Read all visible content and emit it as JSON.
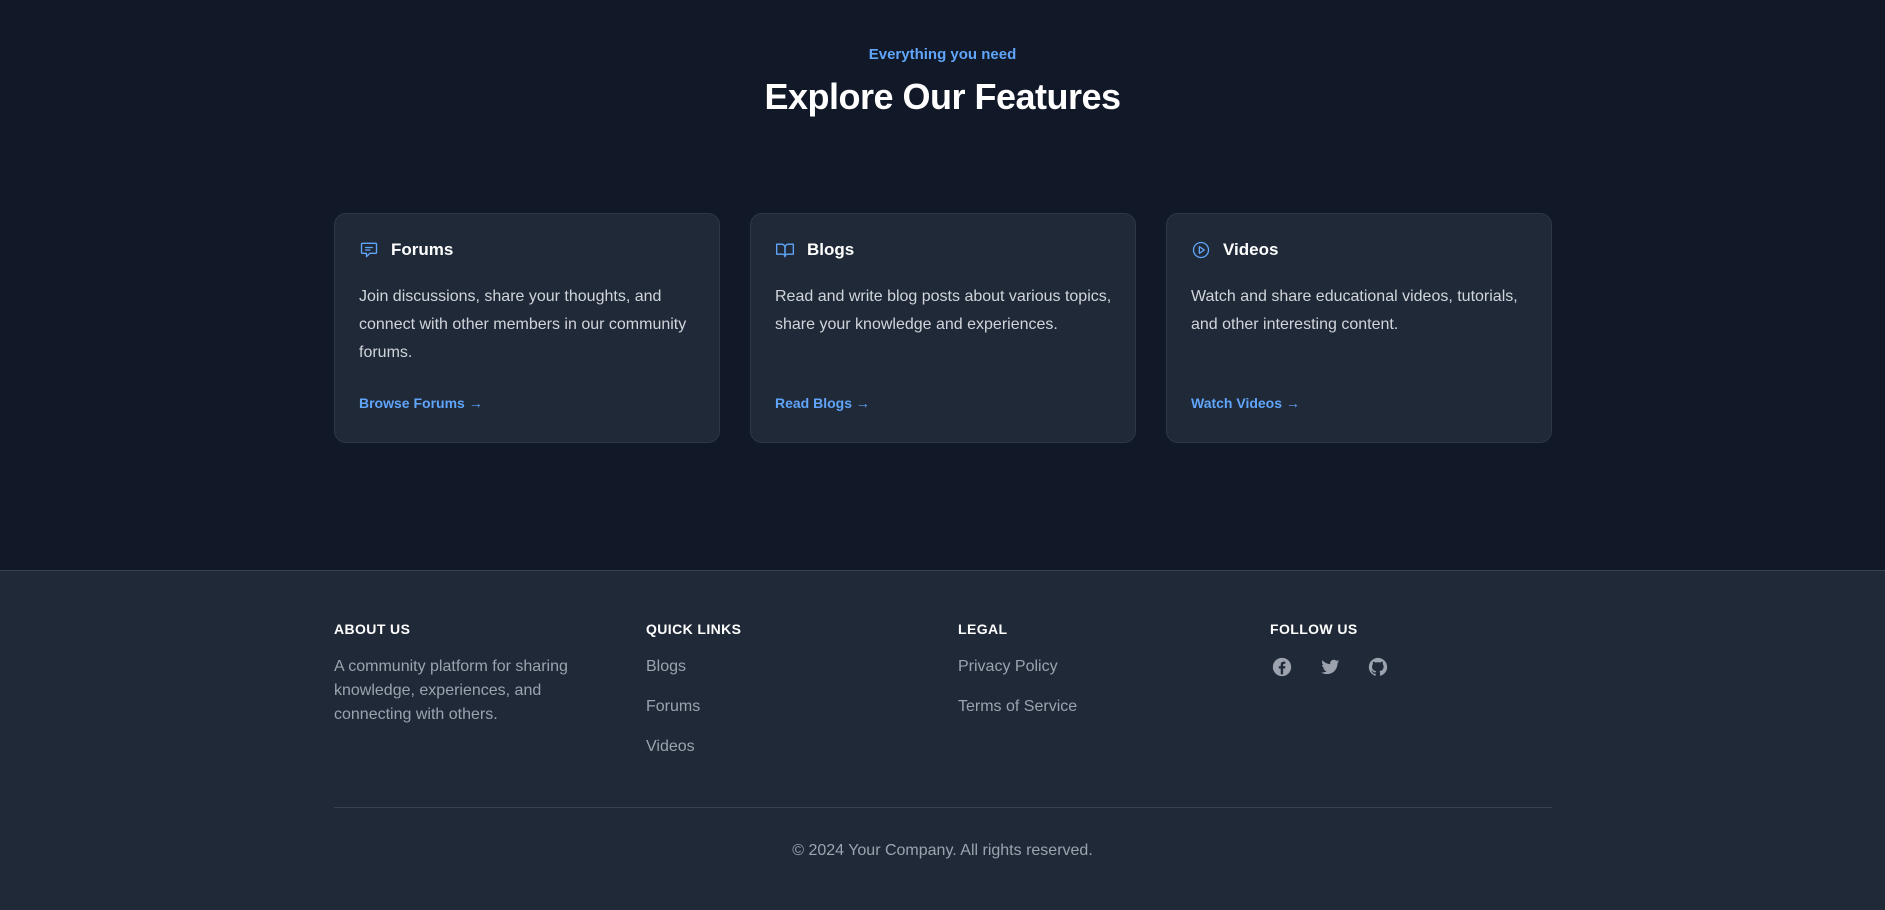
{
  "features": {
    "eyebrow": "Everything you need",
    "title": "Explore Our Features",
    "cards": [
      {
        "icon": "chat-bubble-icon",
        "title": "Forums",
        "description": "Join discussions, share your thoughts, and connect with other members in our community forums.",
        "link": "Browse Forums →"
      },
      {
        "icon": "book-open-icon",
        "title": "Blogs",
        "description": "Read and write blog posts about various topics, share your knowledge and experiences.",
        "link": "Read Blogs →"
      },
      {
        "icon": "play-circle-icon",
        "title": "Videos",
        "description": "Watch and share educational videos, tutorials, and other interesting content.",
        "link": "Watch Videos →"
      }
    ]
  },
  "footer": {
    "about": {
      "title": "ABOUT US",
      "text": "A community platform for sharing knowledge, experiences, and connecting with others."
    },
    "quick_links": {
      "title": "QUICK LINKS",
      "items": [
        "Blogs",
        "Forums",
        "Videos"
      ]
    },
    "legal": {
      "title": "LEGAL",
      "items": [
        "Privacy Policy",
        "Terms of Service"
      ]
    },
    "follow": {
      "title": "FOLLOW US",
      "icons": [
        "facebook-icon",
        "twitter-icon",
        "github-icon"
      ]
    },
    "copyright": "© 2024 Your Company. All rights reserved."
  },
  "colors": {
    "background": "#111827",
    "card": "#1f2937",
    "accent": "#60a5fa",
    "muted": "#9ca3af"
  }
}
